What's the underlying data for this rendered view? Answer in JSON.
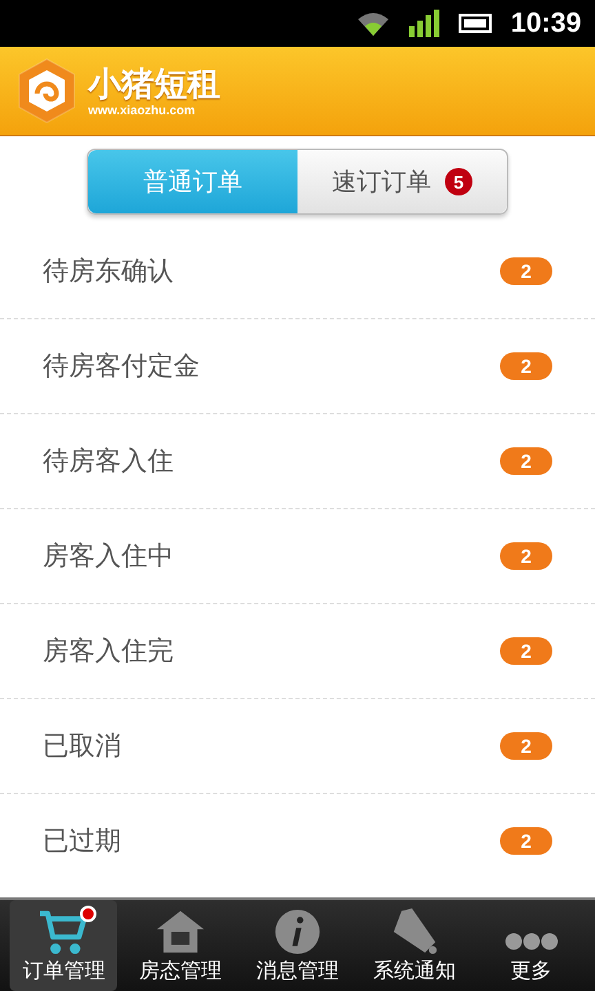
{
  "status_bar": {
    "time": "10:39"
  },
  "header": {
    "app_name": "小猪短租",
    "url": "www.xiaozhu.com"
  },
  "tabs": [
    {
      "label": "普通订单",
      "selected": true
    },
    {
      "label": "速订订单",
      "selected": false,
      "badge": "5"
    }
  ],
  "orders": [
    {
      "label": "待房东确认",
      "count": "2"
    },
    {
      "label": "待房客付定金",
      "count": "2"
    },
    {
      "label": "待房客入住",
      "count": "2"
    },
    {
      "label": "房客入住中",
      "count": "2"
    },
    {
      "label": "房客入住完",
      "count": "2"
    },
    {
      "label": "已取消",
      "count": "2"
    },
    {
      "label": "已过期",
      "count": "2"
    }
  ],
  "bottom_nav": [
    {
      "kind": "cart",
      "label": "订单管理",
      "selected": true,
      "dot": true
    },
    {
      "kind": "house",
      "label": "房态管理",
      "selected": false,
      "dot": false
    },
    {
      "kind": "info",
      "label": "消息管理",
      "selected": false,
      "dot": false
    },
    {
      "kind": "horn",
      "label": "系统通知",
      "selected": false,
      "dot": false
    },
    {
      "kind": "more",
      "label": "更多",
      "selected": false,
      "dot": false
    }
  ]
}
